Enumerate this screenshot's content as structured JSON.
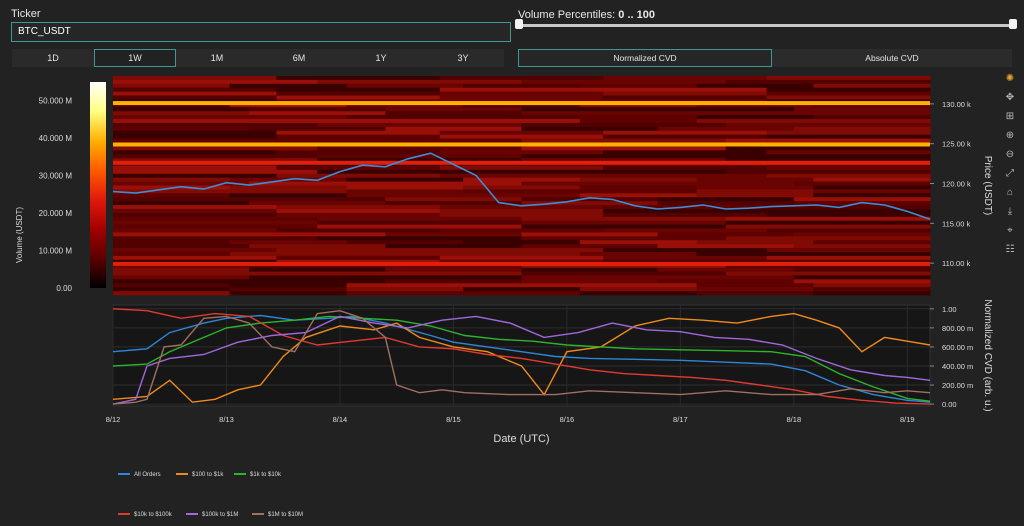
{
  "ticker": {
    "label": "Ticker",
    "value": "BTC_USDT"
  },
  "volume_percentiles": {
    "label": "Volume Percentiles: ",
    "range": "0 .. 100",
    "low": 0,
    "high": 100
  },
  "timeframes": [
    {
      "label": "1D",
      "active": false
    },
    {
      "label": "1W",
      "active": true
    },
    {
      "label": "1M",
      "active": false
    },
    {
      "label": "6M",
      "active": false
    },
    {
      "label": "1Y",
      "active": false
    },
    {
      "label": "3Y",
      "active": false
    }
  ],
  "cvd_modes": [
    {
      "label": "Normalized CVD",
      "active": true
    },
    {
      "label": "Absolute CVD",
      "active": false
    }
  ],
  "modebar_icons": [
    "plotly-logo-icon",
    "pan-icon",
    "zoom-icon",
    "zoom-in-icon",
    "zoom-out-icon",
    "autoscale-icon",
    "reset-icon",
    "download-icon",
    "spike-icon",
    "hover-icon"
  ],
  "chart_data": [
    {
      "type": "heatmap",
      "colorbar_label": "Volume (USDT)",
      "colorbar_ticks": [
        "0.00",
        "10.000 M",
        "20.000 M",
        "30.000 M",
        "40.000 M",
        "50.000 M"
      ],
      "colorscale": [
        "#000000",
        "#5a0000",
        "#a30000",
        "#e01a0a",
        "#ff5a00",
        "#ffb000",
        "#ffff80",
        "#ffffff"
      ],
      "y_axis_label": "Price (USDT)",
      "y_ticks": [
        "110.00 k",
        "115.00 k",
        "120.00 k",
        "125.00 k",
        "130.00 k"
      ],
      "y_tick_values": [
        110000,
        115000,
        120000,
        125000,
        130000
      ],
      "ylim": [
        106000,
        133500
      ],
      "hot_levels": [
        {
          "price": 130100,
          "intensity": 0.85
        },
        {
          "price": 124900,
          "intensity": 0.9
        },
        {
          "price": 122600,
          "intensity": 0.5
        },
        {
          "price": 109900,
          "intensity": 0.45
        }
      ],
      "price_line": {
        "color": "#3a8fd8",
        "x": [
          0,
          0.2,
          0.4,
          0.6,
          0.8,
          1.0,
          1.2,
          1.4,
          1.6,
          1.8,
          2.0,
          2.2,
          2.4,
          2.6,
          2.8,
          3.0,
          3.2,
          3.4,
          3.6,
          3.8,
          4.0,
          4.2,
          4.4,
          4.6,
          4.8,
          5.0,
          5.2,
          5.4,
          5.6,
          5.8,
          6.0,
          6.2,
          6.4,
          6.6,
          6.8,
          7.0,
          7.2
        ],
        "y": [
          119000,
          118800,
          119200,
          119600,
          119300,
          120100,
          119800,
          120200,
          120600,
          120400,
          121500,
          122300,
          122100,
          123100,
          123800,
          122400,
          121000,
          117600,
          117200,
          117400,
          117700,
          118200,
          118000,
          117200,
          116800,
          117000,
          117300,
          116800,
          116900,
          117100,
          117200,
          117300,
          117000,
          117600,
          117300,
          116500,
          115500
        ]
      }
    },
    {
      "type": "line",
      "xlabel": "Date (UTC)",
      "ylabel": "Normalized CVD (arb. u.)",
      "x_ticks": [
        "8/12",
        "8/13",
        "8/14",
        "8/15",
        "8/16",
        "8/17",
        "8/18",
        "8/19"
      ],
      "y_ticks": [
        "0.00",
        "200.00 m",
        "400.00 m",
        "600.00 m",
        "800.00 m",
        "1.00"
      ],
      "ylim": [
        -0.02,
        1.04
      ],
      "series": [
        {
          "name": "All Orders",
          "color": "#2e86d6",
          "x": [
            0,
            0.3,
            0.5,
            0.8,
            1.0,
            1.3,
            1.6,
            1.9,
            2.1,
            2.4,
            2.8,
            3.0,
            3.3,
            3.6,
            3.9,
            4.2,
            4.6,
            5.0,
            5.4,
            5.8,
            6.1,
            6.4,
            6.7,
            7.0,
            7.2
          ],
          "y": [
            0.55,
            0.58,
            0.75,
            0.85,
            0.9,
            0.93,
            0.88,
            0.9,
            0.92,
            0.85,
            0.72,
            0.65,
            0.6,
            0.55,
            0.5,
            0.48,
            0.47,
            0.46,
            0.44,
            0.42,
            0.35,
            0.2,
            0.1,
            0.04,
            0.02
          ]
        },
        {
          "name": "$100 to $1k",
          "color": "#f08a1c",
          "x": [
            0,
            0.3,
            0.5,
            0.7,
            0.9,
            1.1,
            1.3,
            1.5,
            1.7,
            2.0,
            2.3,
            2.5,
            2.7,
            3.0,
            3.3,
            3.6,
            3.8,
            4.0,
            4.3,
            4.6,
            4.9,
            5.2,
            5.5,
            5.8,
            6.0,
            6.2,
            6.4,
            6.6,
            6.8,
            7.0,
            7.2
          ],
          "y": [
            0.05,
            0.08,
            0.25,
            0.02,
            0.05,
            0.15,
            0.2,
            0.5,
            0.7,
            0.82,
            0.78,
            0.85,
            0.7,
            0.6,
            0.55,
            0.4,
            0.1,
            0.55,
            0.6,
            0.82,
            0.9,
            0.88,
            0.85,
            0.92,
            0.95,
            0.88,
            0.8,
            0.55,
            0.7,
            0.66,
            0.62
          ]
        },
        {
          "name": "$1k to $10k",
          "color": "#2cb52c",
          "x": [
            0,
            0.3,
            0.5,
            0.8,
            1.0,
            1.3,
            1.6,
            1.9,
            2.2,
            2.5,
            2.8,
            3.1,
            3.4,
            3.7,
            4.0,
            4.3,
            4.6,
            5.0,
            5.4,
            5.8,
            6.1,
            6.4,
            6.7,
            7.0,
            7.2
          ],
          "y": [
            0.4,
            0.42,
            0.55,
            0.7,
            0.8,
            0.85,
            0.88,
            0.92,
            0.9,
            0.88,
            0.82,
            0.72,
            0.68,
            0.66,
            0.62,
            0.6,
            0.58,
            0.57,
            0.56,
            0.55,
            0.5,
            0.32,
            0.18,
            0.06,
            0.03
          ]
        },
        {
          "name": "$10k to $100k",
          "color": "#e23a30",
          "x": [
            0,
            0.3,
            0.6,
            0.9,
            1.2,
            1.5,
            1.8,
            2.1,
            2.4,
            2.7,
            3.0,
            3.3,
            3.6,
            3.9,
            4.2,
            4.5,
            4.8,
            5.1,
            5.4,
            5.7,
            6.0,
            6.3,
            6.6,
            6.9,
            7.2
          ],
          "y": [
            1.0,
            0.98,
            0.9,
            0.95,
            0.92,
            0.72,
            0.62,
            0.66,
            0.7,
            0.6,
            0.58,
            0.52,
            0.48,
            0.42,
            0.36,
            0.32,
            0.3,
            0.28,
            0.25,
            0.2,
            0.15,
            0.08,
            0.04,
            0.01,
            0.0
          ]
        },
        {
          "name": "$100k to $1M",
          "color": "#a068dc",
          "x": [
            0,
            0.2,
            0.3,
            0.5,
            0.8,
            1.1,
            1.4,
            1.7,
            2.0,
            2.3,
            2.6,
            2.9,
            3.2,
            3.5,
            3.8,
            4.1,
            4.4,
            4.7,
            5.0,
            5.3,
            5.6,
            5.9,
            6.2,
            6.5,
            6.8,
            7.0,
            7.2
          ],
          "y": [
            0.0,
            0.05,
            0.4,
            0.48,
            0.52,
            0.65,
            0.72,
            0.75,
            0.92,
            0.85,
            0.8,
            0.88,
            0.92,
            0.85,
            0.7,
            0.75,
            0.85,
            0.78,
            0.76,
            0.7,
            0.68,
            0.62,
            0.48,
            0.36,
            0.3,
            0.28,
            0.25
          ]
        },
        {
          "name": "$1M to $10M",
          "color": "#a07060",
          "x": [
            0,
            0.2,
            0.3,
            0.45,
            0.6,
            0.8,
            1.0,
            1.2,
            1.4,
            1.6,
            1.8,
            2.0,
            2.2,
            2.4,
            2.5,
            2.7,
            2.9,
            3.1,
            3.5,
            3.9,
            4.2,
            4.6,
            5.0,
            5.4,
            5.8,
            6.2,
            6.5,
            6.8,
            7.0,
            7.2
          ],
          "y": [
            0.0,
            0.02,
            0.05,
            0.6,
            0.62,
            0.9,
            0.92,
            0.85,
            0.6,
            0.55,
            0.95,
            0.98,
            0.9,
            0.7,
            0.2,
            0.12,
            0.15,
            0.12,
            0.1,
            0.1,
            0.14,
            0.12,
            0.1,
            0.14,
            0.1,
            0.1,
            0.16,
            0.12,
            0.14,
            0.12
          ]
        }
      ]
    }
  ],
  "legend": [
    "All Orders",
    "$100 to $1k",
    "$1k to $10k",
    "$10k to $100k",
    "$100k to $1M",
    "$1M to $10M"
  ]
}
